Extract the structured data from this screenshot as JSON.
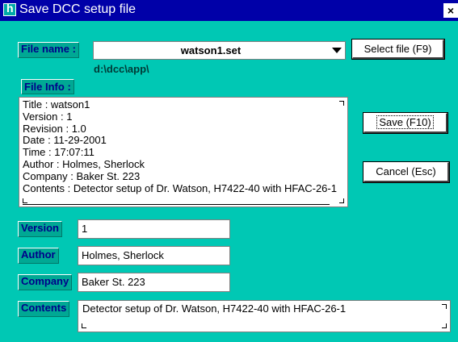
{
  "window": {
    "title": "Save DCC setup file",
    "close_label": "×"
  },
  "file": {
    "label": "File name :",
    "value": "watson1.set",
    "path": "d:\\dcc\\app\\",
    "select_button": "Select file (F9)"
  },
  "info": {
    "label": "File Info :",
    "lines": [
      "Title : watson1",
      "Version : 1",
      "Revision : 1.0",
      "Date : 11-29-2001",
      "Time : 17:07:11",
      "Author : Holmes, Sherlock",
      "Company : Baker St. 223",
      "Contents : Detector setup of Dr. Watson, H7422-40 with HFAC-26-1"
    ]
  },
  "buttons": {
    "save": "Save (F10)",
    "cancel": "Cancel (Esc)"
  },
  "fields": {
    "version": {
      "label": "Version",
      "value": "1"
    },
    "author": {
      "label": "Author",
      "value": "Holmes, Sherlock"
    },
    "company": {
      "label": "Company",
      "value": "Baker St. 223"
    },
    "contents": {
      "label": "Contents",
      "value": "Detector setup of Dr. Watson, H7422-40 with HFAC-26-1"
    }
  },
  "colors": {
    "background": "#00c8b4",
    "titlebar": "#0000a8",
    "label_bg": "#00a894",
    "label_text": "#00008a"
  }
}
